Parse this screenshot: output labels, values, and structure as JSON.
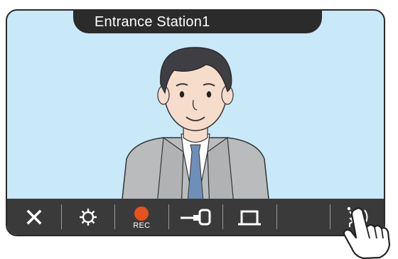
{
  "window": {
    "title": "Entrance Station1"
  },
  "toolbar": {
    "buttons": [
      {
        "icon": "close-icon"
      },
      {
        "icon": "gear-icon"
      },
      {
        "icon": "record-icon",
        "label": "REC"
      },
      {
        "icon": "door-release-icon"
      },
      {
        "icon": "light-icon"
      },
      {
        "icon": "blank"
      },
      {
        "icon": "talk-icon"
      }
    ]
  },
  "colors": {
    "screen_bg": "#c9e8f8",
    "toolbar_bg": "#3a3a3a",
    "title_bg": "#2b2b2b",
    "rec": "#e8501e"
  }
}
